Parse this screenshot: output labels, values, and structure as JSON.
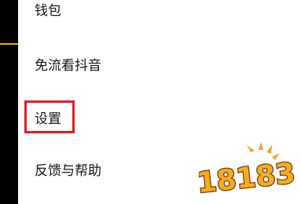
{
  "menu": {
    "items": [
      {
        "label": "钱包"
      },
      {
        "label": "免流看抖音"
      },
      {
        "label": "设置"
      },
      {
        "label": "反馈与帮助"
      }
    ],
    "highlighted_item": "设置"
  },
  "watermark": {
    "text": "18183"
  },
  "colors": {
    "highlight": "#e31b23",
    "accent": "#e0b100",
    "panel": "#ffffff",
    "text": "#161616"
  }
}
